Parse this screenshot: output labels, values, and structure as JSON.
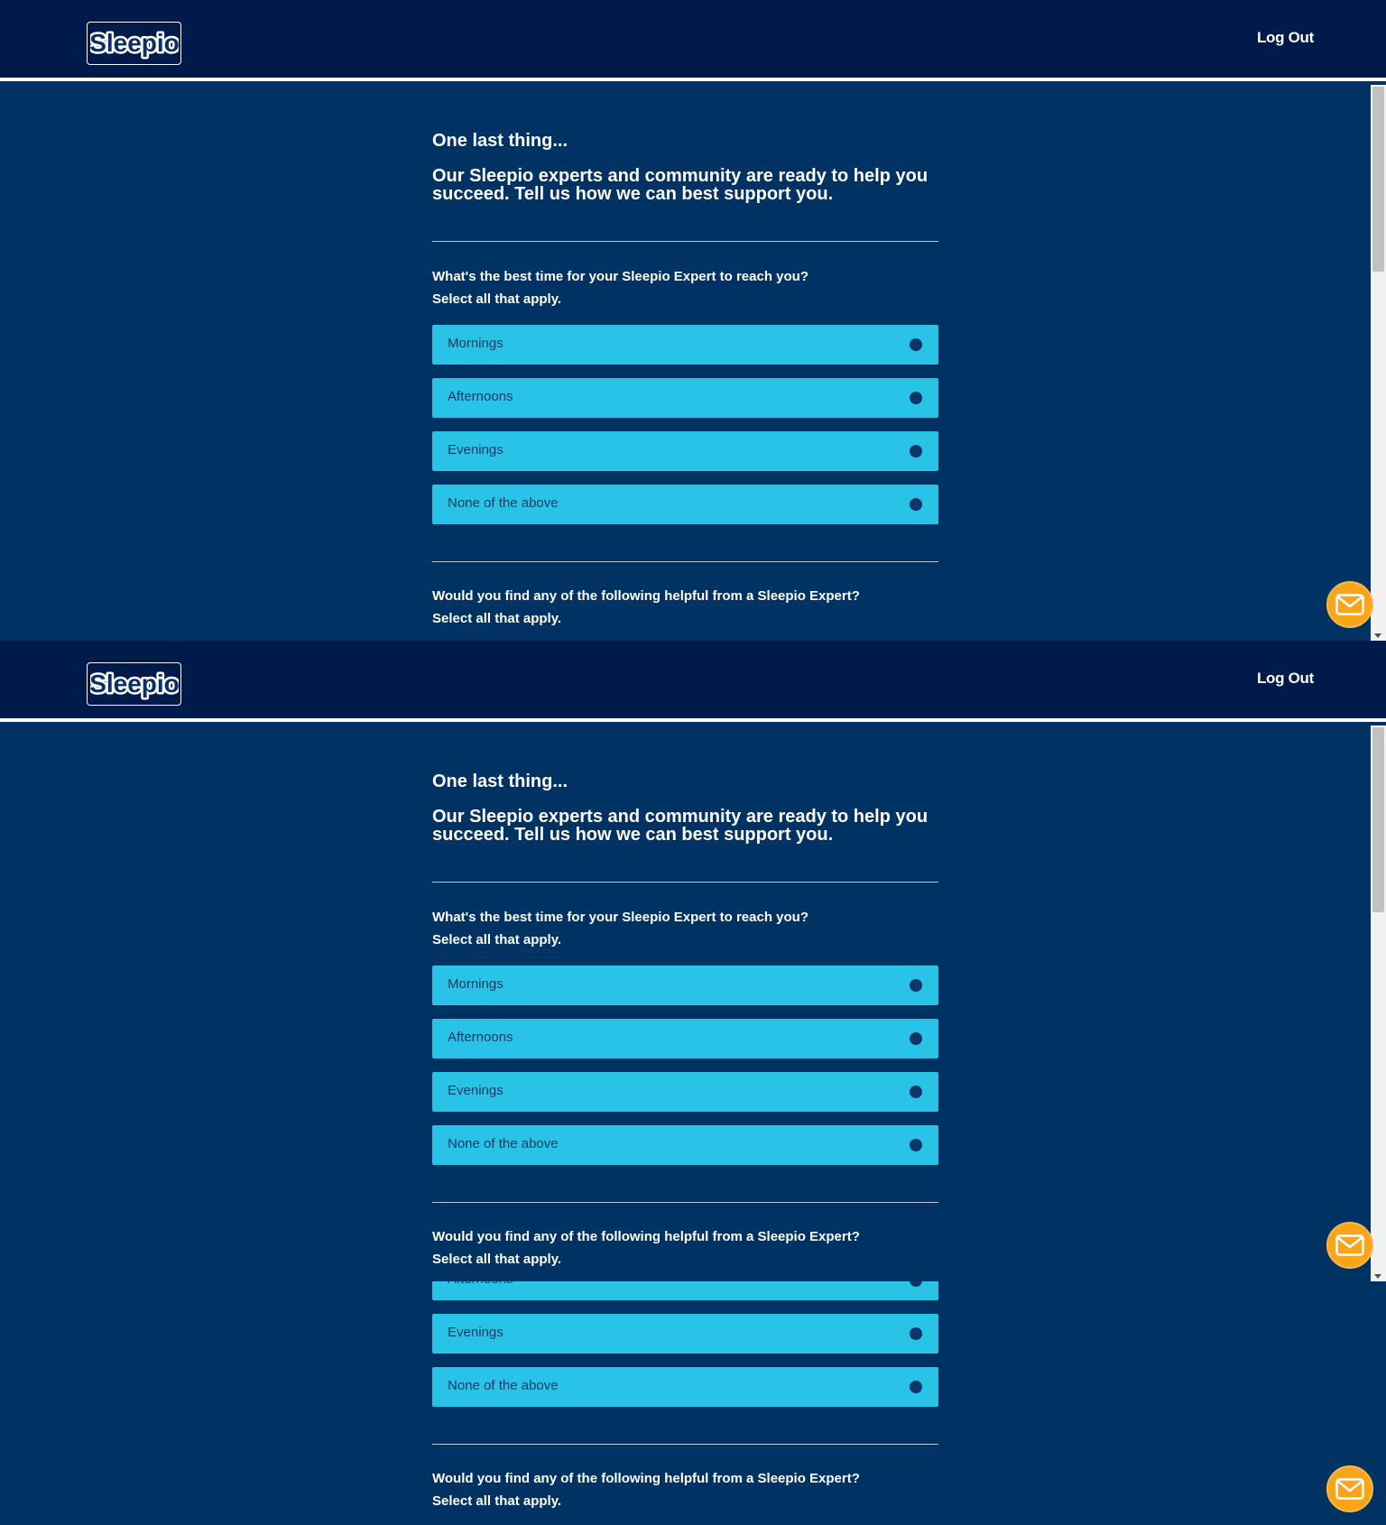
{
  "header": {
    "logo_text": "Sleepio",
    "logout_label": "Log Out"
  },
  "intro": {
    "lead": "One last thing...",
    "message": "Our Sleepio experts and community are ready to help you succeed. Tell us how we can best support you."
  },
  "question1": {
    "prompt": "What's the best time for your Sleepio Expert to reach you?",
    "instruction": "Select all that apply.",
    "options": [
      {
        "label": "Mornings"
      },
      {
        "label": "Afternoons"
      },
      {
        "label": "Evenings"
      },
      {
        "label": "None of the above"
      }
    ]
  },
  "question2": {
    "prompt": "Would you find any of the following helpful from a Sleepio Expert?",
    "instruction": "Select all that apply."
  },
  "colors": {
    "header_bg": "#001a4b",
    "page_bg": "#003363",
    "option_bg": "#28c3e6",
    "mail_button": "#f9a51b"
  },
  "icons": {
    "contact": "mail-icon"
  }
}
